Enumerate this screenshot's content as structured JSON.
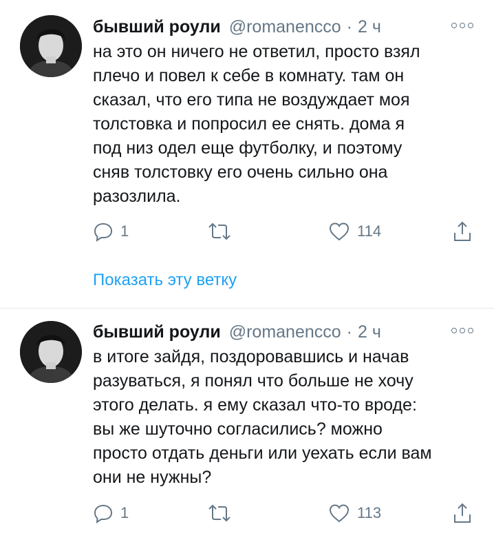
{
  "colors": {
    "text": "#14171a",
    "muted": "#657786",
    "link": "#1da1f2",
    "divider": "#e1e8ed"
  },
  "icons": {
    "reply": "reply-icon",
    "retweet": "retweet-icon",
    "like": "heart-icon",
    "share": "share-icon",
    "more": "more-icon"
  },
  "tweets": [
    {
      "name": "бывший роули",
      "handle": "@romanencco",
      "separator": "·",
      "time": "2 ч",
      "text": "на это он ничего не ответил, просто взял\nплечо и повел к себе в комнату. там он\nсказал, что его типа не воздуждает моя\nтолстовка и попросил ее снять. дома я\nпод низ одел еще футболку, и поэтому\nсняв толстовку его очень сильно она\nразозлила.",
      "replies": "1",
      "likes": "114",
      "thread_link": "Показать эту ветку"
    },
    {
      "name": "бывший роули",
      "handle": "@romanencco",
      "separator": "·",
      "time": "2 ч",
      "text": "в итоге зайдя, поздоровавшись и начав\nразуваться, я понял что больше не хочу\nэтого делать. я ему сказал что-то вроде:\nвы же шуточно согласились? можно\nпросто отдать деньги или уехать если вам\nони не нужны?",
      "replies": "1",
      "likes": "113"
    }
  ]
}
